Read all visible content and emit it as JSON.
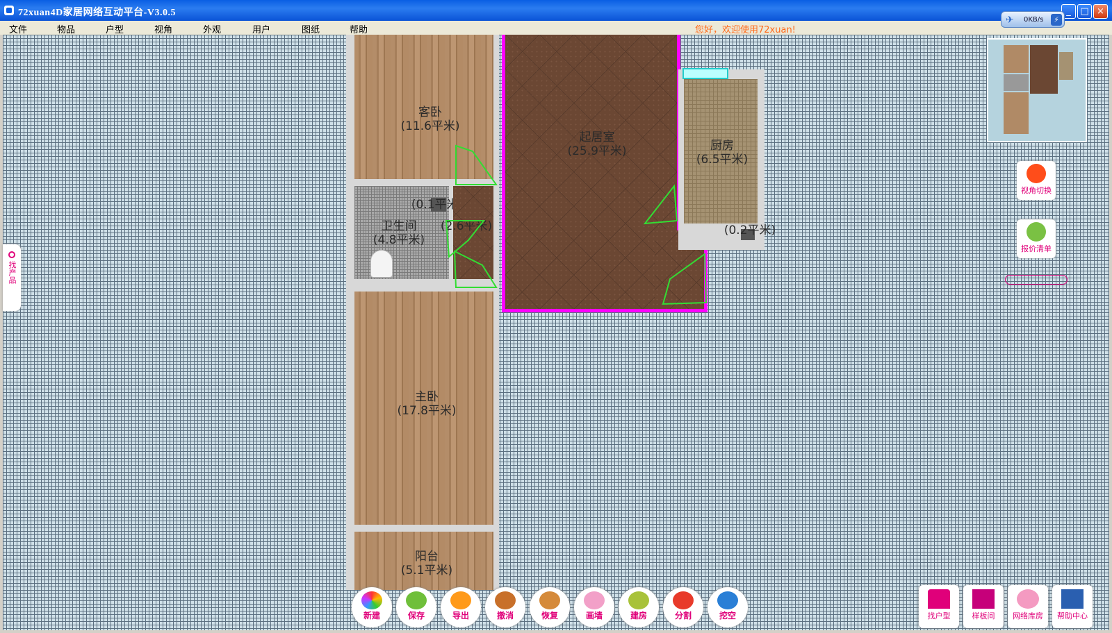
{
  "window": {
    "title": "72xuan4D家居网络互动平台-V3.0.5",
    "net_speed": "0KB/s",
    "controls": {
      "minimize": "_",
      "maximize": "□",
      "close": "×"
    }
  },
  "menu": {
    "items": [
      "文件",
      "物品",
      "户型",
      "视角",
      "外观",
      "用户",
      "图纸",
      "帮助"
    ],
    "greeting": "您好，欢迎使用72xuan!"
  },
  "floorplan": {
    "rooms": [
      {
        "name": "客卧",
        "area": "(11.6平米)"
      },
      {
        "name": "卫生间",
        "area": "(4.8平米)"
      },
      {
        "name": "",
        "area": "(0.1平米)"
      },
      {
        "name": "",
        "area": "(2.6平米)"
      },
      {
        "name": "起居室",
        "area": "(25.9平米)"
      },
      {
        "name": "厨房",
        "area": "(6.5平米)"
      },
      {
        "name": "",
        "area": "(0.2平米)"
      },
      {
        "name": "主卧",
        "area": "(17.8平米)"
      },
      {
        "name": "阳台",
        "area": "(5.1平米)"
      }
    ]
  },
  "side_panel": {
    "find_product": "找产品",
    "view_switch": "视角切换",
    "quote_list": "报价清单"
  },
  "toolbar": {
    "tools": [
      "新建",
      "保存",
      "导出",
      "撤消",
      "恢复",
      "画墙",
      "建房",
      "分割",
      "挖空"
    ]
  },
  "nav": {
    "items": [
      "找户型",
      "样板间",
      "网络库房",
      "帮助中心"
    ]
  },
  "colors": {
    "accent": "#e0007a",
    "selection": "#ff00ff",
    "door_outline": "#33dd33",
    "greeting": "#ff6a1a"
  }
}
